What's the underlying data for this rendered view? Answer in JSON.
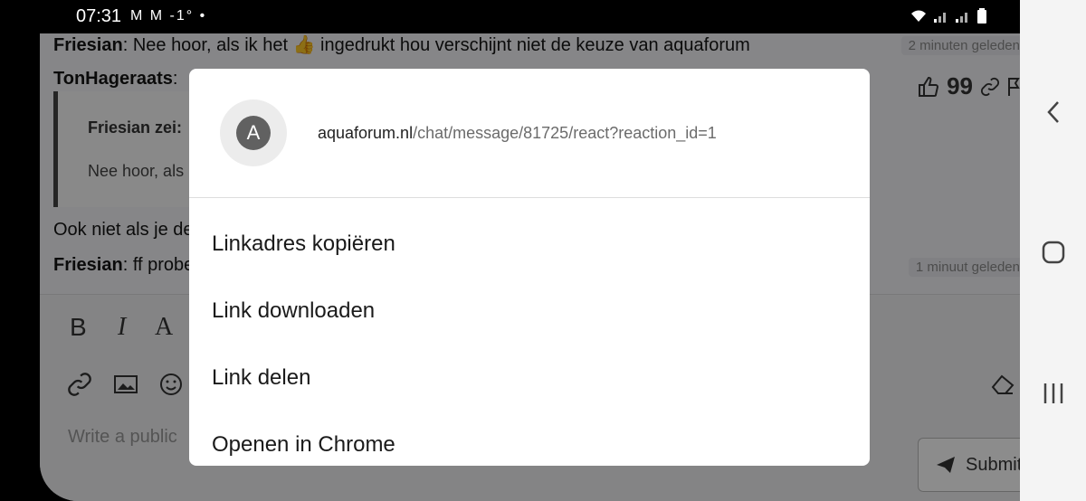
{
  "status_bar": {
    "time": "07:31",
    "notifications": "M M -1° •",
    "icons": [
      "wifi-icon",
      "signal-icon",
      "signal-icon",
      "battery-icon"
    ]
  },
  "chat": {
    "messages": [
      {
        "author": "Friesian",
        "text": ": Nee hoor, als ik het 👍 ingedrukt hou verschijnt niet de keuze van aquaforum",
        "time": "2 minuten geleden"
      },
      {
        "author": "TonHageraats",
        "text": ":"
      },
      {
        "author": "",
        "text": "Ook niet als je de"
      },
      {
        "author": "Friesian",
        "text": ": ff probe",
        "time": "1 minuut geleden"
      }
    ],
    "quote": {
      "name": "Friesian zei:",
      "text": "Nee hoor, als"
    }
  },
  "editor": {
    "toolbar": [
      "B",
      "I",
      "A"
    ],
    "placeholder": "Write a public",
    "submit_label": "Submit"
  },
  "dialog": {
    "avatar_letter": "A",
    "url_domain": "aquaforum.nl",
    "url_path": "/chat/message/81725/react?reaction_id=1",
    "menu": [
      {
        "label": "Linkadres kopiëren"
      },
      {
        "label": "Link downloaden"
      },
      {
        "label": "Link delen"
      },
      {
        "label": "Openen in Chrome"
      }
    ]
  },
  "nav_bar": {
    "buttons": [
      "back-icon",
      "home-icon",
      "recents-icon"
    ]
  }
}
